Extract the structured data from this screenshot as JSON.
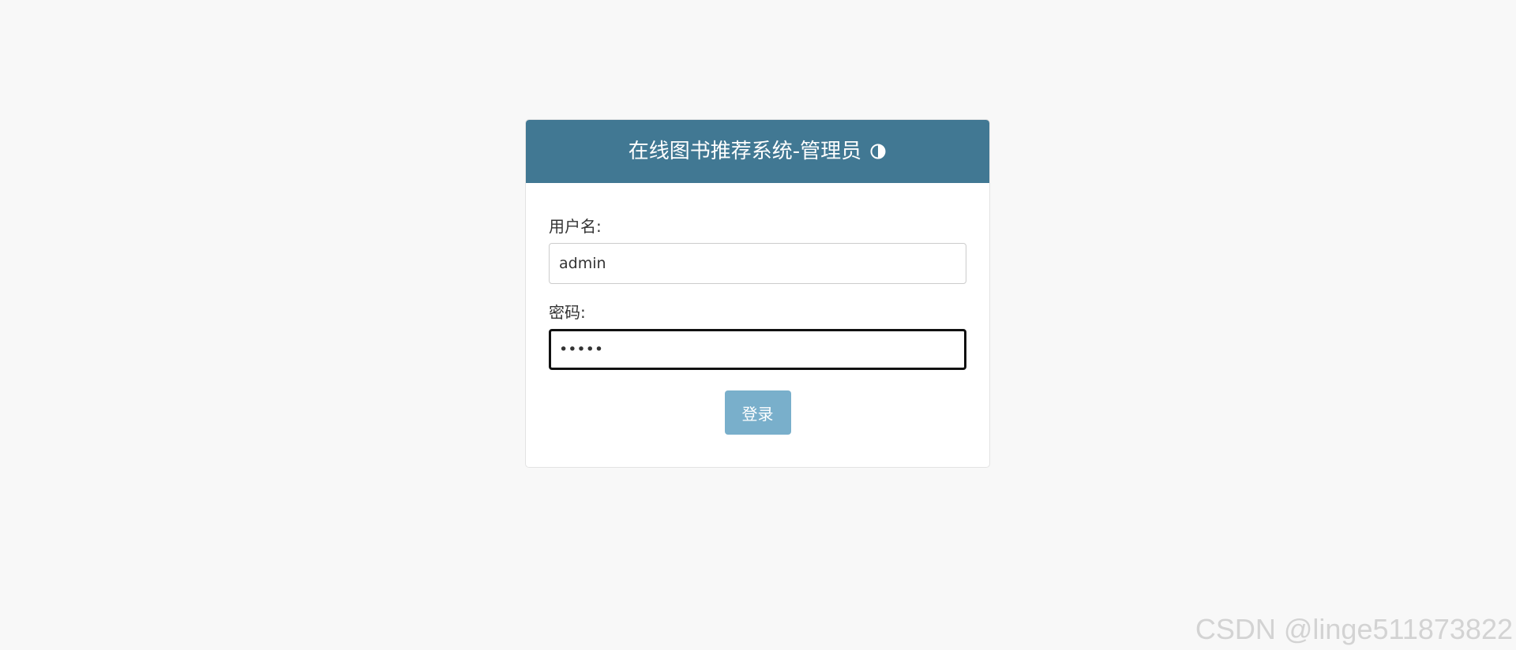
{
  "header": {
    "title": "在线图书推荐系统-管理员",
    "theme_icon": "contrast-icon"
  },
  "form": {
    "username": {
      "label": "用户名:",
      "value": "admin"
    },
    "password": {
      "label": "密码:",
      "value": "•••••"
    },
    "submit_label": "登录"
  },
  "watermark": {
    "text": "CSDN @linge511873822"
  },
  "colors": {
    "page_background": "#f8f8f8",
    "header_background": "#417893",
    "button_background": "#79afcb",
    "focused_border": "#111111"
  }
}
